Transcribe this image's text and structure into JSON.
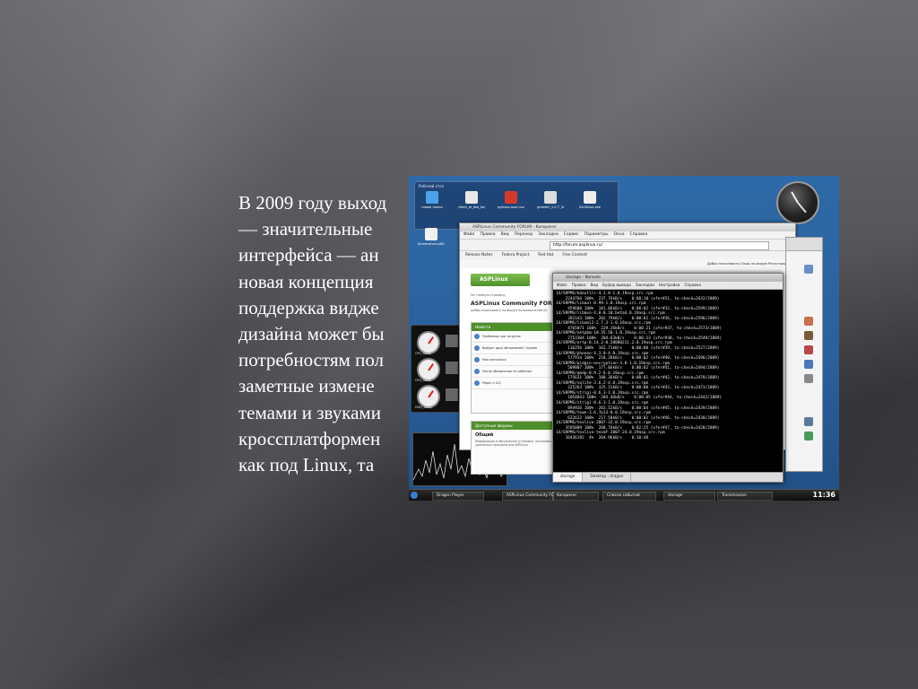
{
  "slide": {
    "text_lines": [
      "В 2009 году выход",
      "— значительные",
      "интерфейса — ан",
      "новая концепция",
      "поддержка видже",
      "дизайна может бы",
      "потребностям пол",
      "заметные измене",
      "темами и звуками",
      "кроссплатформен",
      "как под Linux, та"
    ]
  },
  "desktop": {
    "panel_title": "Рабочий стол",
    "icons": [
      {
        "label": "новая папка",
        "color": "#4aa3e8"
      },
      {
        "label": "client_id_dsa_key",
        "color": "#e8e8e8"
      },
      {
        "label": "pyleoss.aspl nux.com.ua",
        "color": "#d43a2a"
      },
      {
        "label": "greader_1.0 7_3rd.exe",
        "color": "#dcdcdc"
      },
      {
        "label": "SA-Setup.exe",
        "color": "#eeeeee"
      },
      {
        "label": "Screenshot-pdf0_cd.ai...",
        "color": "#f0f0f0"
      }
    ],
    "gauges": [
      "CPU_Temp",
      "CPU_Temp",
      "HDD_Temp"
    ]
  },
  "browser": {
    "title": "ASPLinux Community FORUM - Konqueror",
    "menu": [
      "Файл",
      "Правка",
      "Вид",
      "Переход",
      "Закладки",
      "Сервис",
      "Параметры",
      "Окно",
      "Справка"
    ],
    "url": "http://forum.asplinux.ru/",
    "bookmarks": [
      "Release Notes",
      "Fedora Project",
      "Red Hat",
      "Free Content"
    ],
    "forum_topbar": "Добро пожаловать!  Вход на форум  Регистрация",
    "logo_text": "ASPLinux",
    "breadcrumb": "На главную страницу",
    "heading": "ASPLinux Community FORU",
    "subheading": "Добро пожаловать на форум пользователей AS",
    "box_title": "Новости",
    "topics": [
      "Проблемы при загрузке",
      "Выйдет диск обновлений / Update",
      "Моя консолька",
      "После обновления не работает",
      "Pidgin и ICQ"
    ],
    "box2_title": "Доступные форумы",
    "box2_heading": "Общий",
    "box2_text": "Информация и обсуждение установки, настройки и удаленных программ для ASPLinux"
  },
  "terminal": {
    "title": "storage - Konsole",
    "menu": [
      "Файл",
      "Правка",
      "Вид",
      "Буфер вывода",
      "Закладки",
      "Настройка",
      "Справка"
    ],
    "lines": [
      "14/SRPMS/kdeutils-4.2.0-1.0.19asp.src.rpm",
      "    2244766 100%  237.76kB/s    0:00:10 (xfer#31, to-check=2632/2889)",
      "14/SRPMS/libaal-0.99-1.0.19asp.src.rpm",
      "     459600 100%  181.86kB/s    0:00:02 (xfer#32, to-check=2599/2889)",
      "14/SRPMS/libmsn-4.0-0.10.beta4.0.19asp.src.rpm",
      "     281143 100%  202.79kB/s    0:00:01 (xfer#36, to-check=2596/2889)",
      "14/SRPMS/libxml2-2.7.3-1.0.19asp.src.rpm",
      "     4765071 100%  229.26kB/s    0:00:21 (xfer#37, to-check=2573/2889)",
      "14/SRPMS/netpbm-10.35.58-1.0.19asp.src.rpm",
      "     2753304 100%  204.63kB/s    0:00:13 (xfer#38, to-check=2549/2889)",
      "14/SRPMS/ortp-0.14.2-0.20080211.2.0.19asp.src.rpm",
      "     116256 100%  162.71kB/s    0:00:00 (xfer#39, to-check=2527/2889)",
      "14/SRPMS/phonon-4.3.0-4.0.19asp.src.rpm",
      "     577914 100%  218.28kB/s    0:00:02 (xfer#40, to-check=2496/2889)",
      "14/SRPMS/pidgin-encryption-3.0-1.0.19asp.src.rpm",
      "     509807 100%  177.06kB/s    0:00:02 (xfer#41, to-check=2494/2889)",
      "14/SRPMS/qmdp-0.9.2-6.0.19asp.src.rpm",
      "     175631 100%  188.36kB/s    0:00:01 (xfer#42, to-check=2478/2889)",
      "14/SRPMS/sqlite-3.6.2-4.0.19asp.src.rpm",
      "     225263 100%  325.31kB/s    0:00:00 (xfer#43, to-check=2473/2889)",
      "14/SRPMS/strigi-0.6.3-1.0.19asp.src.rpm",
      "     1054043 100%  204.46kB/s    0:00:05 (xfer#44, to-check=2442/2889)",
      "14/SRPMS/strigi-0.6.3-1.0.19asp.src.rpm",
      "     894926 100%  203.52kB/s    0:00:04 (xfer#45, to-check=2439/2889)",
      "14/SRPMS/tewn-3.6.7p13-0.0.19asp.src.rpm",
      "     622622 100%  217.58kB/s    0:00:02 (xfer#46, to-check=2430/2889)",
      "14/SRPMS/texlive-2007-32.0.19asp.src.rpm",
      "    3595009 100%  208.76kB/s    0:02:25 (xfer#47, to-check=2428/2889)",
      "14/SRPMS/texlive-texmf-2007-24.0.19asp.src.rpm",
      "    16436192  4%  204.96kB/s    0:10:48"
    ],
    "tabs": [
      "storage",
      "Desktop : dragon"
    ]
  },
  "taskbar": {
    "tasks": [
      "Dragon Player",
      "ASPLinux Community FOR...",
      "Konqueror",
      "Список событий",
      "storage",
      "Transmission"
    ],
    "clock": "11:36"
  }
}
